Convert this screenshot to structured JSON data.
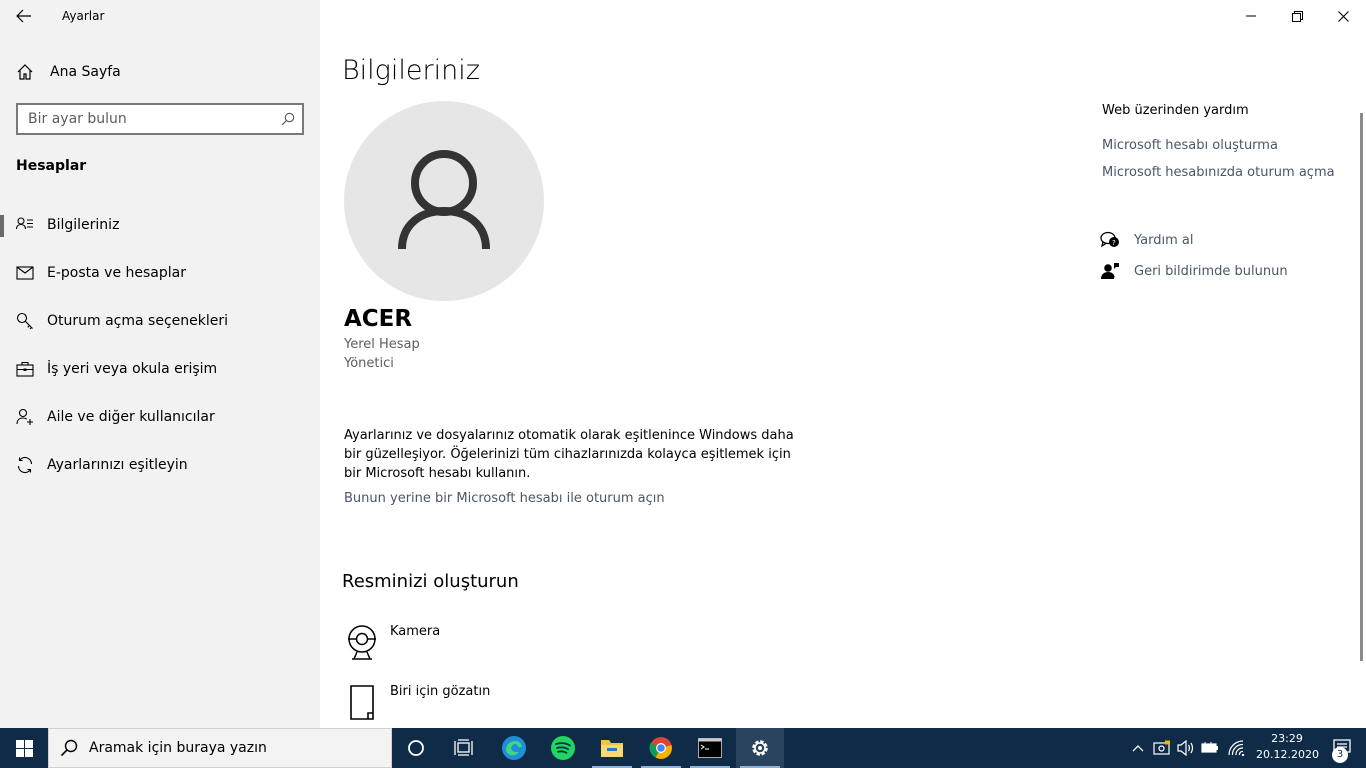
{
  "window": {
    "app_title": "Ayarlar",
    "controls": [
      "minimize",
      "restore",
      "close"
    ]
  },
  "sidebar": {
    "home_label": "Ana Sayfa",
    "search_placeholder": "Bir ayar bulun",
    "section_heading": "Hesaplar",
    "items": [
      {
        "label": "Bilgileriniz",
        "icon": "person-list-icon",
        "active": true
      },
      {
        "label": "E-posta ve hesaplar",
        "icon": "mail-icon",
        "active": false
      },
      {
        "label": "Oturum açma seçenekleri",
        "icon": "key-icon",
        "active": false
      },
      {
        "label": "İş yeri veya okula erişim",
        "icon": "briefcase-icon",
        "active": false
      },
      {
        "label": "Aile ve diğer kullanıcılar",
        "icon": "add-person-icon",
        "active": false
      },
      {
        "label": "Ayarlarınızı eşitleyin",
        "icon": "sync-icon",
        "active": false
      }
    ]
  },
  "main": {
    "title": "Bilgileriniz",
    "user_name": "ACER",
    "account_type": "Yerel Hesap",
    "account_role": "Yönetici",
    "sync_description": "Ayarlarınız ve dosyalarınız otomatik olarak eşitlenince Windows daha bir güzelleşiyor. Öğelerinizi tüm cihazlarınızda kolayca eşitlemek için bir Microsoft hesabı kullanın.",
    "ms_signin_link": "Bunun yerine bir Microsoft hesabı ile oturum açın",
    "picture_heading": "Resminizi oluşturun",
    "picture_options": [
      {
        "label": "Kamera",
        "icon": "camera-icon"
      },
      {
        "label": "Biri için gözatın",
        "icon": "browse-icon"
      }
    ]
  },
  "help": {
    "heading": "Web üzerinden yardım",
    "links": [
      "Microsoft hesabı oluşturma",
      "Microsoft hesabınızda oturum açma"
    ],
    "get_help": "Yardım al",
    "feedback": "Geri bildirimde bulunun"
  },
  "taskbar": {
    "search_placeholder": "Aramak için buraya yazın",
    "apps": [
      "cortana-icon",
      "task-view-icon",
      "edge-icon",
      "spotify-icon",
      "file-explorer-icon",
      "chrome-icon",
      "terminal-icon",
      "settings-icon"
    ],
    "time": "23:29",
    "date": "20.12.2020",
    "notification_count": "3"
  },
  "colors": {
    "sidebar_bg": "#f2f2f2",
    "taskbar_bg": "#0f2b47",
    "link": "#4a5768",
    "avatar_bg": "#e6e6e6"
  }
}
